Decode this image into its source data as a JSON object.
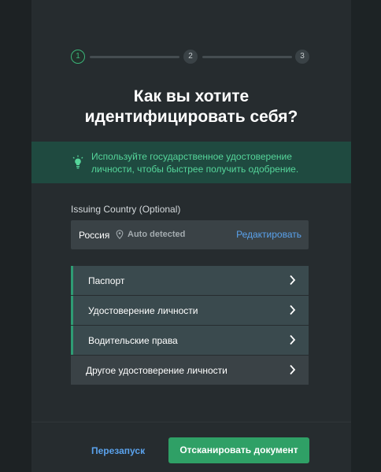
{
  "stepper": {
    "steps": [
      "1",
      "2",
      "3"
    ],
    "current": 1
  },
  "title": {
    "line1": "Как вы хотите",
    "line2": "идентифицировать себя?"
  },
  "banner": {
    "icon": "lightbulb-icon",
    "text": "Используйте государственное удостоверение личности, чтобы быстрее получить одобрение."
  },
  "issuing_country": {
    "label": "Issuing Country (Optional)",
    "value": "Россия",
    "auto_icon": "location-pin-icon",
    "auto_text": "Auto detected",
    "edit_label": "Редактировать"
  },
  "documents": [
    {
      "label": "Паспорт",
      "recommended": true
    },
    {
      "label": "Удостоверение личности",
      "recommended": true
    },
    {
      "label": "Водительские права",
      "recommended": true
    },
    {
      "label": "Другое удостоверение личности",
      "recommended": false
    }
  ],
  "footer": {
    "restart_label": "Перезапуск",
    "scan_label": "Отсканировать документ"
  },
  "colors": {
    "accent_green": "#2fa066",
    "banner_text": "#55d59a",
    "link_blue": "#5aa2ec"
  }
}
